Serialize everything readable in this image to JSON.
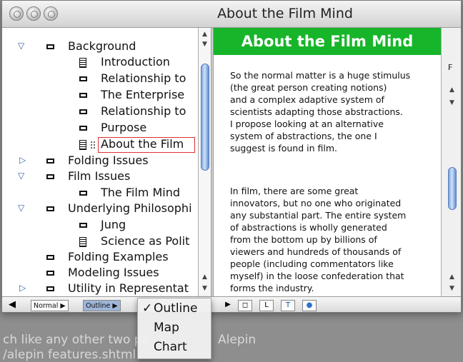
{
  "window": {
    "title": "About the Film Mind"
  },
  "outline": {
    "rows": [
      {
        "label": "Background",
        "tri": "open",
        "icon": "rect"
      },
      {
        "label": "Introduction",
        "icon": "doc"
      },
      {
        "label": "Relationship to",
        "icon": "rect"
      },
      {
        "label": "The Enterprise",
        "icon": "rect"
      },
      {
        "label": "Relationship to",
        "icon": "rect"
      },
      {
        "label": "Purpose",
        "icon": "rect"
      },
      {
        "label": "About the Film",
        "icon": "doc",
        "selected": true
      },
      {
        "label": "Folding Issues",
        "tri": "closed",
        "icon": "rect"
      },
      {
        "label": "Film Issues",
        "tri": "open",
        "icon": "rect"
      },
      {
        "label": "The Film Mind",
        "icon": "rect"
      },
      {
        "label": "Underlying Philosophi",
        "tri": "open",
        "icon": "rect"
      },
      {
        "label": "Jung",
        "icon": "rect"
      },
      {
        "label": "Science as Polit",
        "icon": "doc"
      },
      {
        "label": "Folding Examples",
        "icon": "rect"
      },
      {
        "label": "Modeling Issues",
        "icon": "rect"
      },
      {
        "label": "Utility in Representat",
        "tri": "closed",
        "icon": "rect"
      }
    ]
  },
  "textpane": {
    "header": "About the Film Mind",
    "para1": [
      "So the normal matter is a huge stimulus",
      "(the great person creating notions)",
      "and a complex adaptive system of",
      "scientists adapting those abstractions.",
      "I propose looking at an alternative",
      "system of abstractions, the one I",
      "suggest is found in film."
    ],
    "para2": [
      "In film, there are some great",
      "innovators, but no one who originated",
      "any substantial part. The entire system",
      "of abstractions is wholly generated",
      "from the bottom up by billions of",
      "viewers and hundreds of thousands of",
      "people (including commentators like",
      "myself) in the loose confederation that",
      "forms the industry."
    ]
  },
  "bottombar": {
    "normal": "Normal",
    "outline": "Outline"
  },
  "menu": {
    "items": [
      "Outline",
      "Map",
      "Chart"
    ],
    "checked": "✓"
  },
  "background": {
    "line1": "ch like any other two pa",
    "line1b": "Alepin",
    "line2": "/alepin  features.shtml"
  }
}
